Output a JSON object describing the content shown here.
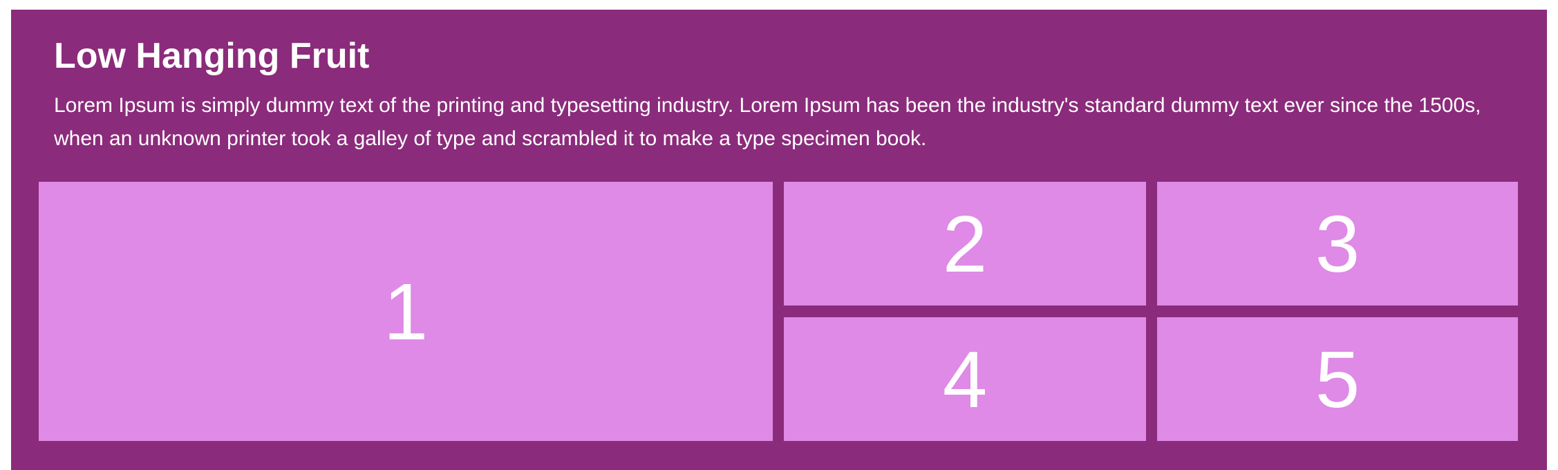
{
  "section": {
    "title": "Low Hanging Fruit",
    "description": "Lorem Ipsum is simply dummy text of the printing and typesetting industry. Lorem Ipsum has been the industry's standard dummy text ever since the 1500s, when an unknown printer took a galley of type and scrambled it to make a type specimen book."
  },
  "grid": {
    "cells": [
      "1",
      "2",
      "3",
      "4",
      "5"
    ]
  },
  "colors": {
    "panel_background": "#8b2b7b",
    "cell_background": "#de8ae6",
    "text": "#ffffff"
  }
}
